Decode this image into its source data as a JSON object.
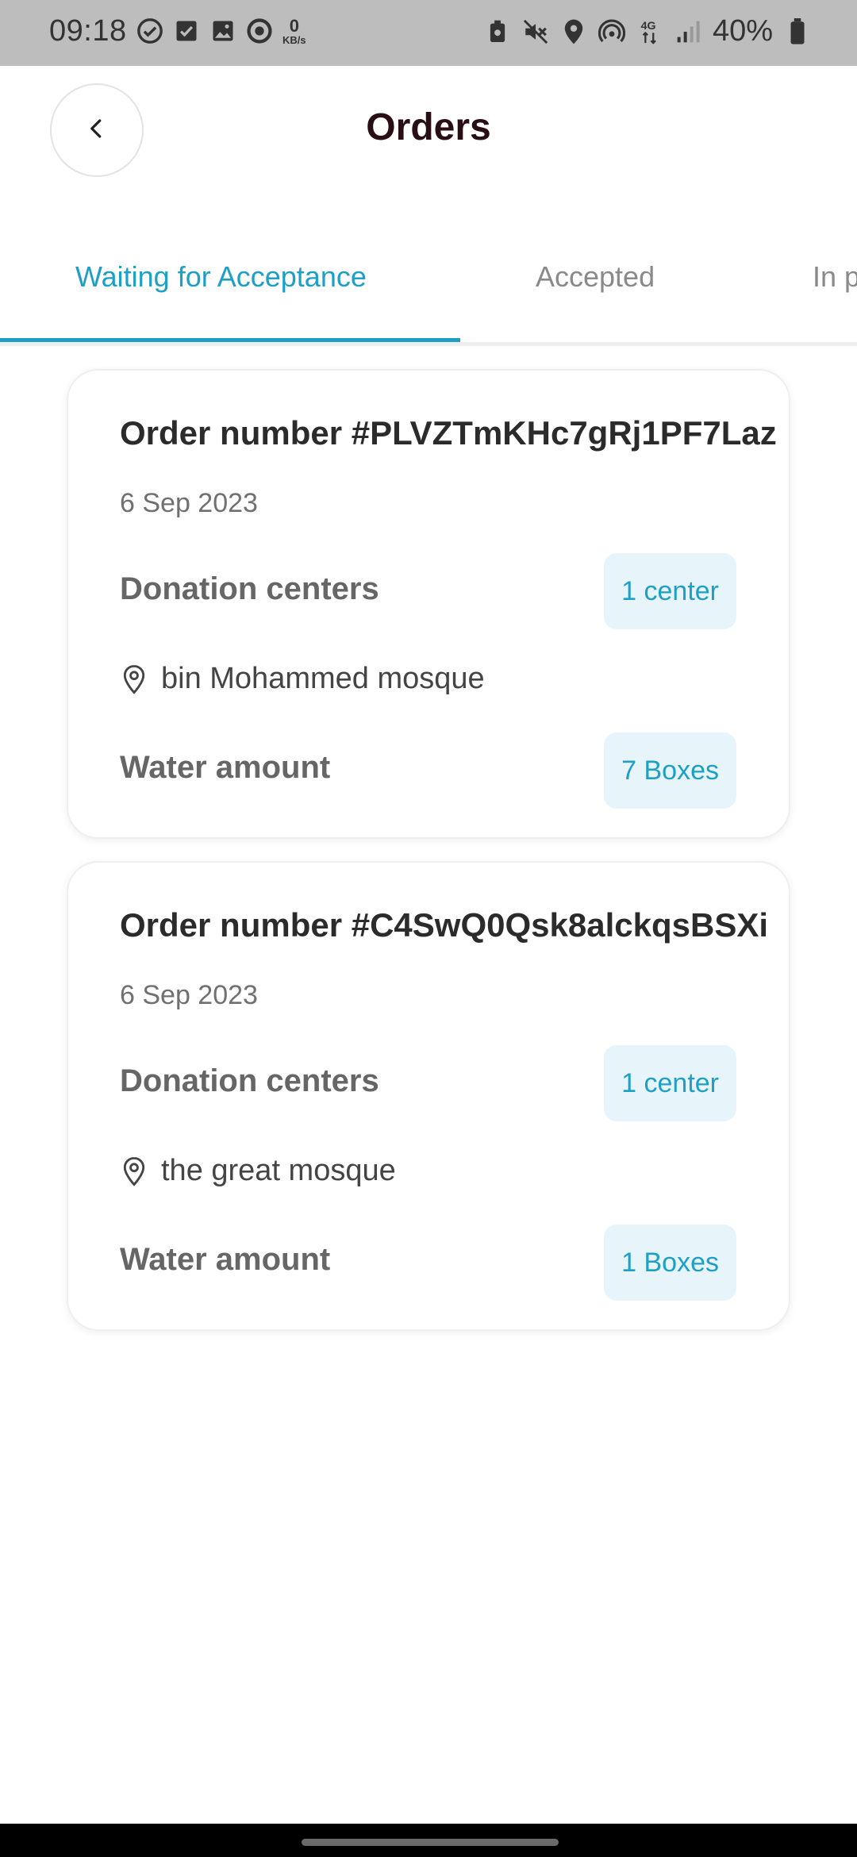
{
  "status_bar": {
    "time": "09:18",
    "net_speed_value": "0",
    "net_speed_unit": "KB/s",
    "battery_pct": "40%",
    "left_icons": [
      "check-circle-icon",
      "check-square-icon",
      "image-icon",
      "sync-icon",
      "network-speed-icon"
    ],
    "right_icons": [
      "backup-icon",
      "mute-icon",
      "location-icon",
      "hotspot-icon",
      "4g-icon",
      "signal-icon",
      "battery-icon"
    ]
  },
  "header": {
    "title": "Orders",
    "back_icon": "chevron-left-icon"
  },
  "tabs": [
    {
      "label": "Waiting for Acceptance",
      "active": true
    },
    {
      "label": "Accepted",
      "active": false
    },
    {
      "label": "In p",
      "active": false
    }
  ],
  "orders": [
    {
      "title": "Order number #PLVZTmKHc7gRj1PF7Laz",
      "date": "6 Sep 2023",
      "centers_label": "Donation centers",
      "centers_count": "1 center",
      "location": "bin Mohammed mosque",
      "water_label": "Water amount",
      "water_amount": "7 Boxes"
    },
    {
      "title": "Order number #C4SwQ0Qsk8alckqsBSXi",
      "date": "6 Sep 2023",
      "centers_label": "Donation centers",
      "centers_count": "1 center",
      "location": "the great mosque",
      "water_label": "Water amount",
      "water_amount": "1 Boxes"
    }
  ],
  "colors": {
    "accent": "#1e9fc6",
    "pill_bg": "#e7f5fa",
    "title": "#2a0e16",
    "status_bar_bg": "#bdbdbd"
  }
}
